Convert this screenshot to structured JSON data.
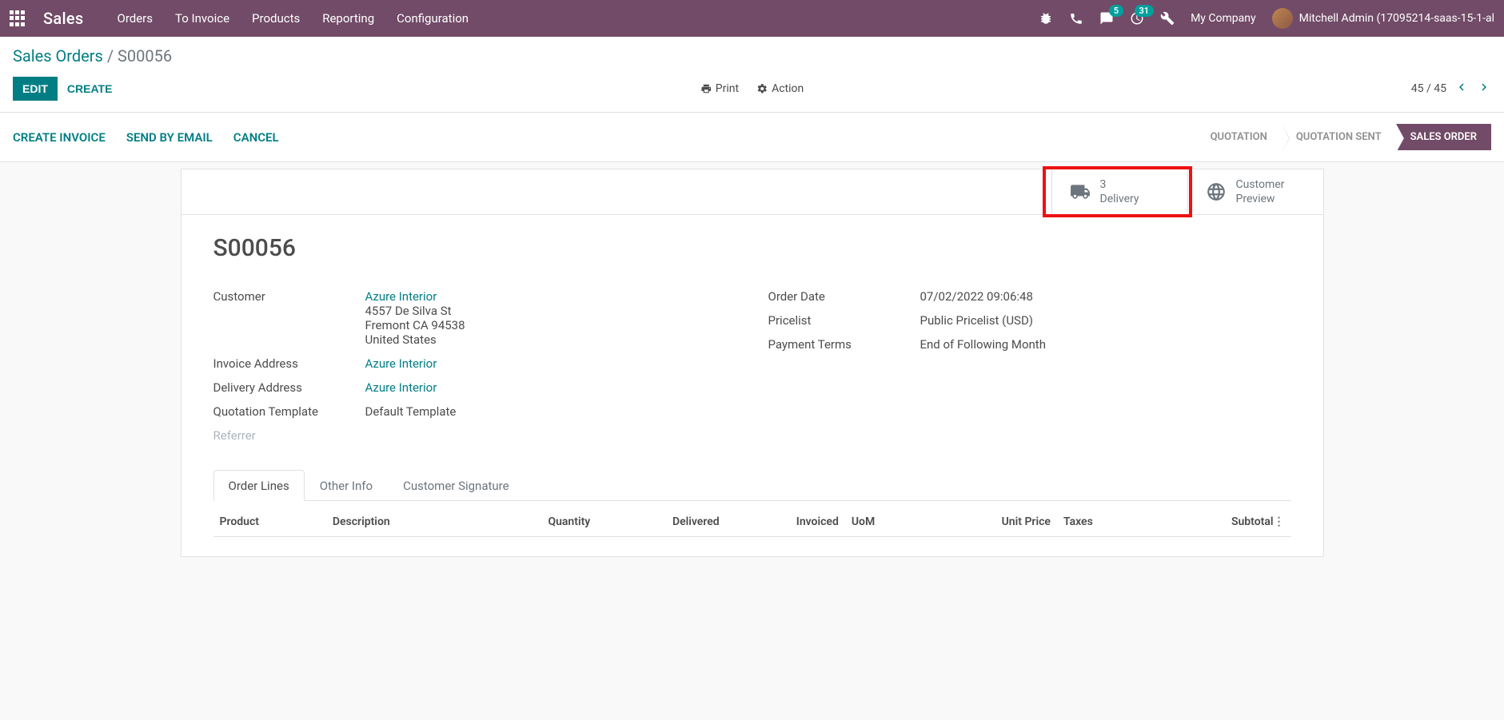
{
  "nav": {
    "brand": "Sales",
    "menu": [
      "Orders",
      "To Invoice",
      "Products",
      "Reporting",
      "Configuration"
    ],
    "messages_badge": "5",
    "activities_badge": "31",
    "company": "My Company",
    "user": "Mitchell Admin (17095214-saas-15-1-al"
  },
  "breadcrumb": {
    "parent": "Sales Orders",
    "current": "S00056"
  },
  "controls": {
    "edit": "EDIT",
    "create": "CREATE",
    "print": "Print",
    "action": "Action",
    "pager": "45 / 45"
  },
  "status_actions": {
    "create_invoice": "CREATE INVOICE",
    "send_email": "SEND BY EMAIL",
    "cancel": "CANCEL"
  },
  "status_steps": {
    "quotation": "QUOTATION",
    "quotation_sent": "QUOTATION SENT",
    "sales_order": "SALES ORDER"
  },
  "stat_buttons": {
    "delivery_count": "3",
    "delivery_label": "Delivery",
    "preview_line1": "Customer",
    "preview_line2": "Preview"
  },
  "order": {
    "name": "S00056",
    "labels": {
      "customer": "Customer",
      "invoice_address": "Invoice Address",
      "delivery_address": "Delivery Address",
      "quotation_template": "Quotation Template",
      "referrer": "Referrer",
      "order_date": "Order Date",
      "pricelist": "Pricelist",
      "payment_terms": "Payment Terms"
    },
    "customer_name": "Azure Interior",
    "customer_addr1": "4557 De Silva St",
    "customer_addr2": "Fremont CA 94538",
    "customer_addr3": "United States",
    "invoice_address": "Azure Interior",
    "delivery_address": "Azure Interior",
    "quotation_template": "Default Template",
    "referrer": "",
    "order_date": "07/02/2022 09:06:48",
    "pricelist": "Public Pricelist (USD)",
    "payment_terms": "End of Following Month"
  },
  "tabs": {
    "order_lines": "Order Lines",
    "other_info": "Other Info",
    "customer_signature": "Customer Signature"
  },
  "table_headers": {
    "product": "Product",
    "description": "Description",
    "quantity": "Quantity",
    "delivered": "Delivered",
    "invoiced": "Invoiced",
    "uom": "UoM",
    "unit_price": "Unit Price",
    "taxes": "Taxes",
    "subtotal": "Subtotal"
  }
}
